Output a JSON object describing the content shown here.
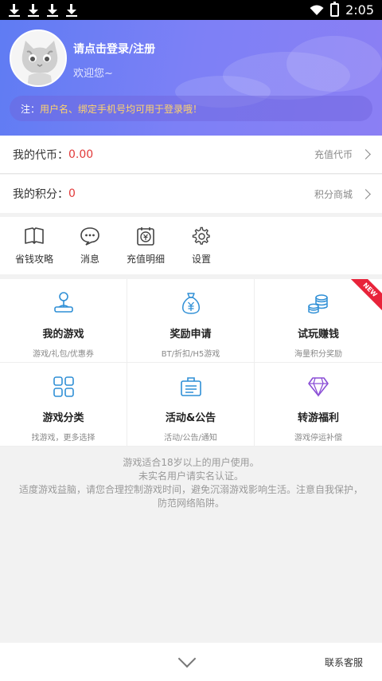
{
  "status": {
    "time": "2:05"
  },
  "user": {
    "login_text": "请点击登录/注册",
    "welcome_text": "欢迎您~",
    "notice_prefix": "注：",
    "notice_text": "用户名、绑定手机号均可用于登录哦！"
  },
  "wallet": {
    "coin_label": "我的代币：",
    "coin_value": "0.00",
    "coin_action": "充值代币",
    "points_label": "我的积分：",
    "points_value": "0",
    "points_action": "积分商城"
  },
  "tools": [
    {
      "label": "省钱攻略",
      "icon": "book-icon"
    },
    {
      "label": "消息",
      "icon": "chat-bubble-icon"
    },
    {
      "label": "充值明细",
      "icon": "recharge-detail-icon"
    },
    {
      "label": "设置",
      "icon": "gear-icon"
    }
  ],
  "features": [
    {
      "title": "我的游戏",
      "subtitle": "游戏/礼包/优惠券",
      "icon": "joystick-icon"
    },
    {
      "title": "奖励申请",
      "subtitle": "BT/折扣/H5游戏",
      "icon": "money-bag-icon"
    },
    {
      "title": "试玩赚钱",
      "subtitle": "海量积分奖励",
      "icon": "coins-icon",
      "badge": "NEW"
    },
    {
      "title": "游戏分类",
      "subtitle": "找游戏，更多选择",
      "icon": "grid-icon"
    },
    {
      "title": "活动&公告",
      "subtitle": "活动/公告/通知",
      "icon": "notice-board-icon"
    },
    {
      "title": "转游福利",
      "subtitle": "游戏停运补偿",
      "icon": "diamond-icon"
    }
  ],
  "tips": {
    "line1": "游戏适合18岁以上的用户使用。",
    "line2": "未实名用户请实名认证。",
    "line3": "适度游戏益脑，请您合理控制游戏时间，避免沉溺游戏影响生活。注意自我保护，防范网络陷阱。"
  },
  "bottom": {
    "contact": "联系客服"
  },
  "colors": {
    "accent": "#6b7ff5",
    "value_red": "#e23a3a",
    "notice_yellow": "#ffd36b",
    "icon_blue": "#2f8fd6",
    "icon_purple": "#8b4fd6"
  }
}
